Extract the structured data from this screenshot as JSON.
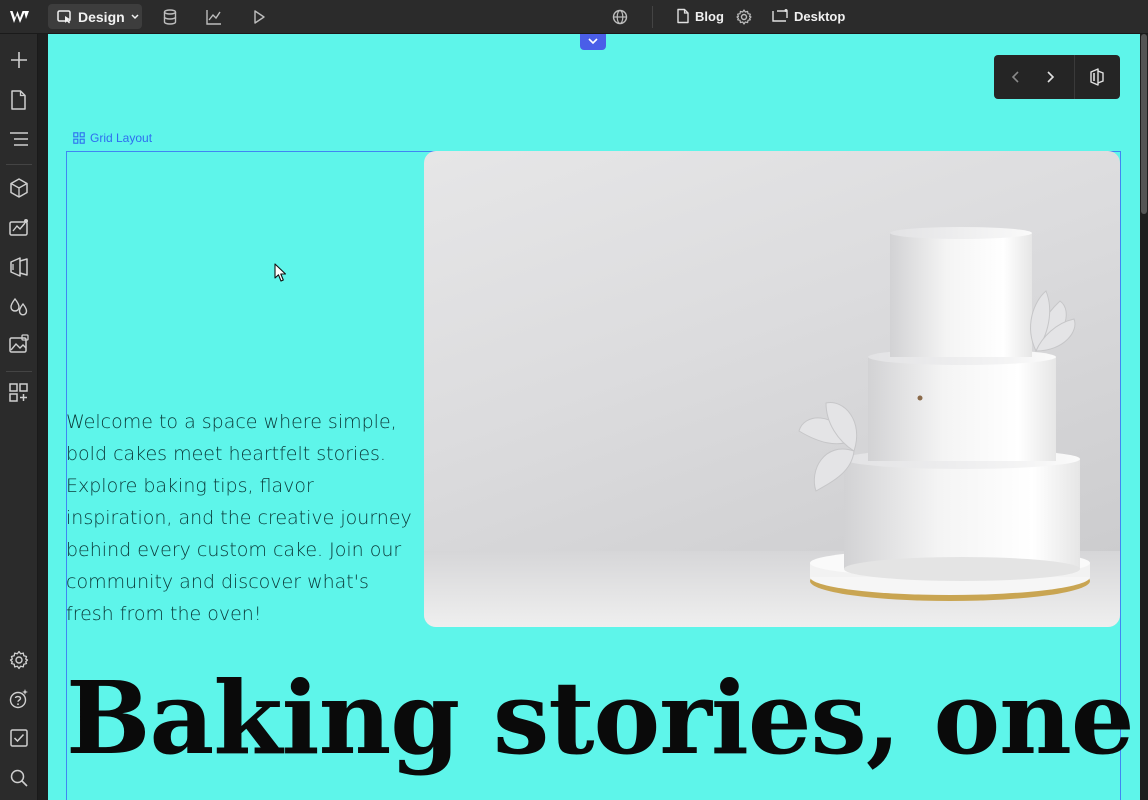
{
  "topbar": {
    "mode_label": "Design",
    "page_label": "Blog",
    "breakpoint_label": "Desktop"
  },
  "canvas": {
    "grid_label": "Grid Layout",
    "intro_text": "Welcome to a space where simple, bold cakes meet heartfelt stories. Explore baking tips, flavor inspiration, and the creative journey behind every custom cake. Join our community and discover what's fresh from the oven!",
    "headline": "Baking stories, one",
    "background_color": "#5ef5ea",
    "selection_color": "#3f86f3"
  }
}
